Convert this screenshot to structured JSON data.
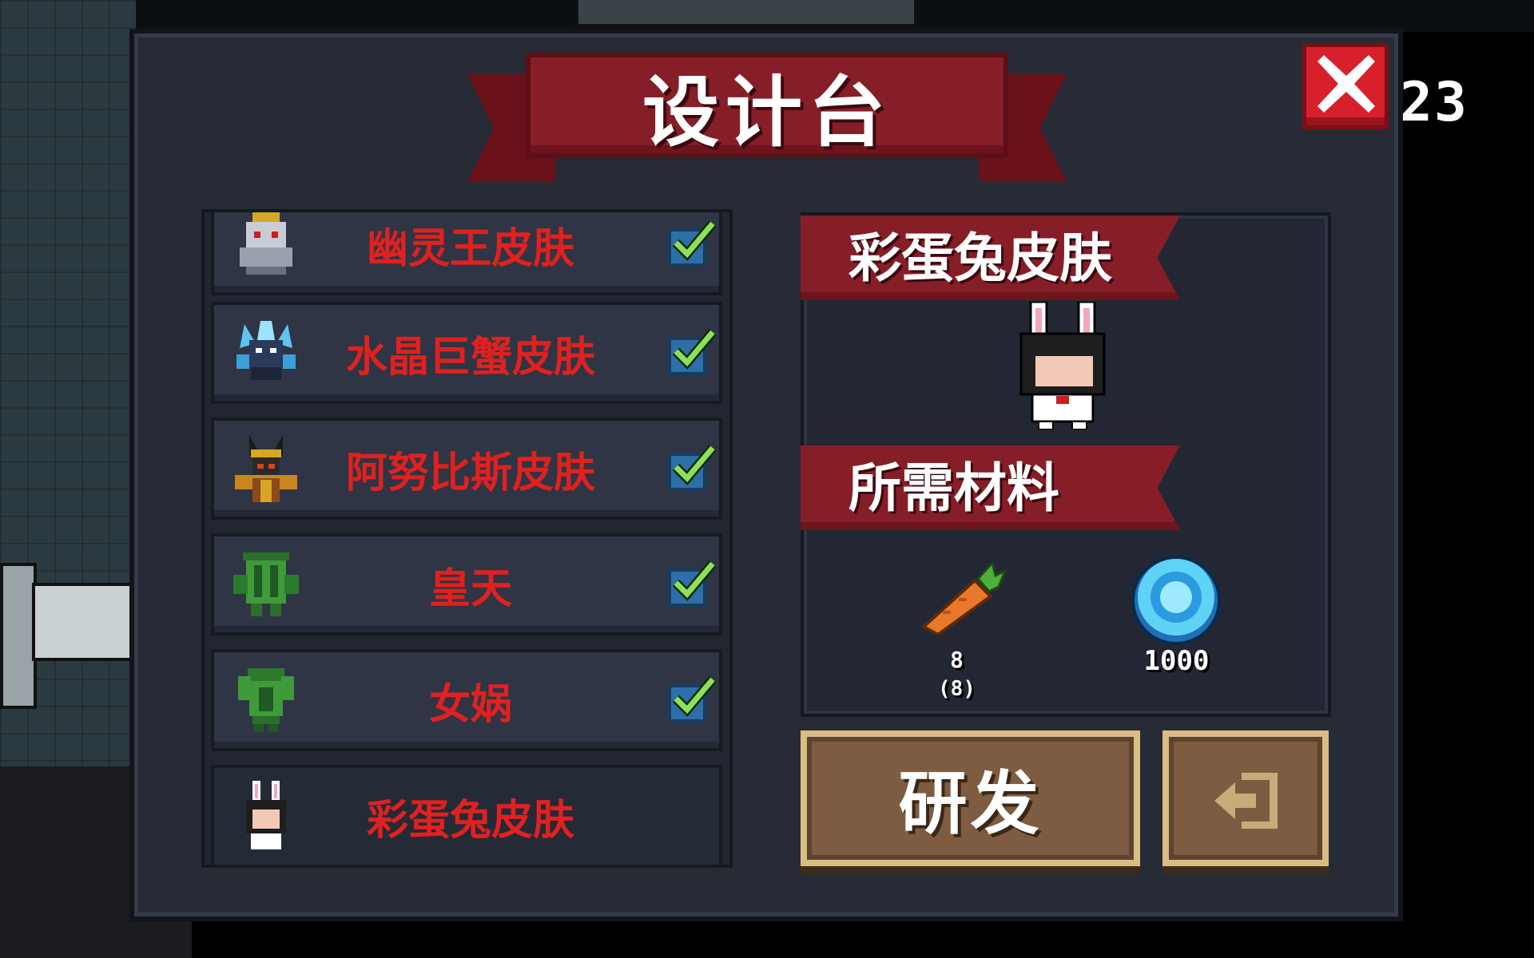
{
  "header": {
    "title": "设计台",
    "counter_fragment": "23"
  },
  "colors": {
    "panel_bg": "#262b36",
    "banner_red": "#861e27",
    "label_red": "#e0211f",
    "check_green": "#8ee05a",
    "check_box_blue": "#2d6fa8",
    "button_brown": "#7d5c42",
    "button_border": "#d9bd83"
  },
  "skin_list": {
    "items": [
      {
        "label": "幽灵王皮肤",
        "icon": "ghost-king-icon",
        "unlocked": true
      },
      {
        "label": "水晶巨蟹皮肤",
        "icon": "crystal-crab-icon",
        "unlocked": true
      },
      {
        "label": "阿努比斯皮肤",
        "icon": "anubis-icon",
        "unlocked": true
      },
      {
        "label": "皇天",
        "icon": "huangtian-icon",
        "unlocked": true
      },
      {
        "label": "女娲",
        "icon": "nuwa-icon",
        "unlocked": true
      },
      {
        "label": "彩蛋兔皮肤",
        "icon": "easter-bunny-icon",
        "unlocked": false
      }
    ]
  },
  "detail": {
    "skin_name": "彩蛋兔皮肤",
    "materials_title": "所需材料",
    "materials": [
      {
        "icon": "carrot-icon",
        "amount": "8",
        "owned": "(8)"
      },
      {
        "icon": "gem-coin-icon",
        "amount": "1000"
      }
    ]
  },
  "actions": {
    "research_label": "研发",
    "exit_icon": "exit-icon"
  }
}
